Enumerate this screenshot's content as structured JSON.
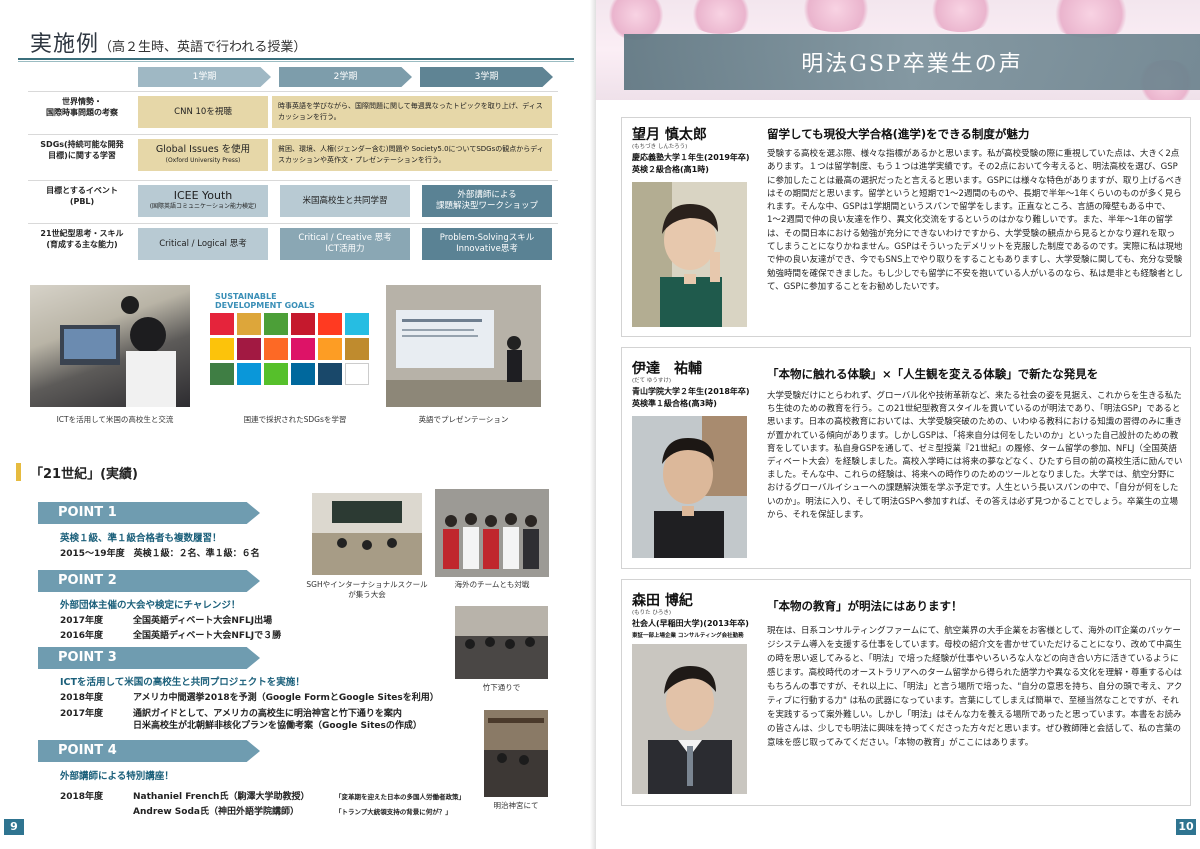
{
  "left": {
    "title": "実施例",
    "subtitle": "（高２生時、英語で行われる授業）",
    "terms": [
      "1学期",
      "2学期",
      "3学期"
    ],
    "rows": [
      {
        "label": "世界情勢・\n国際時事問題の考察",
        "c1": "CNN 10を視聴",
        "c2": "時事英語を学びながら、国際問題に関して毎週異なったトピックを取り上げ、ディスカッションを行う。"
      },
      {
        "label": "SDGs(持続可能な開発\n目標)に関する学習",
        "c1": "Global Issues を使用",
        "c1_small": "(Oxford University Press)",
        "c2": "貧困、環境、人権(ジェンダー含む)問題や Society5.0についてSDGsの観点からディスカッションや英作文・プレゼンテーションを行う。"
      },
      {
        "label": "目標とするイベント\n(PBL)",
        "c1": "ICEE Youth",
        "c1_small": "(国際英語コミュニケーション能力検定)",
        "c2": "米国高校生と共同学習",
        "c3": "外部講師による\n課題解決型ワークショップ"
      },
      {
        "label": "21世紀型思考・スキル\n(育成する主な能力)",
        "c1": "Critical / Logical 思考",
        "c2": "Critical / Creative 思考\nICT活用力",
        "c3": "Problem-Solvingスキル\nInnovative思考"
      }
    ],
    "sdg_title": "SUSTAINABLE\nDEVELOPMENT GOALS",
    "sdg_sub": "17 GOALS TO TRANSFORM OUR WORLD",
    "sdg_colors": [
      "#e5243b",
      "#dda63a",
      "#4c9f38",
      "#c5192d",
      "#ff3a21",
      "#26bde2",
      "#fcc30b",
      "#a21942",
      "#fd6925",
      "#dd1367",
      "#fd9d24",
      "#bf8b2e",
      "#3f7e44",
      "#0a97d9",
      "#56c02b",
      "#00689d",
      "#19486a",
      "#ffffff"
    ],
    "captions": [
      "ICTを活用して米国の高校生と交流",
      "国連で採択されたSDGsを学習",
      "英語でプレゼンテーション"
    ],
    "section_title": "「21世紀」(実績)",
    "points": [
      {
        "label": "POINT 1",
        "lead": "英検１級、準１級合格者も複数履習！",
        "lines": [
          "2015〜19年度　英検１級：２名、準１級：６名"
        ]
      },
      {
        "label": "POINT 2",
        "lead": "外部団体主催の大会や検定にチャレンジ！",
        "lines": [
          "2017年度",
          "全国英語ディベート大会NFLJ出場",
          "2016年度",
          "全国英語ディベート大会NFLJで３勝"
        ]
      },
      {
        "label": "POINT 3",
        "lead": "ICTを活用して米国の高校生と共同プロジェクトを実施！",
        "lines": [
          "2018年度",
          "アメリカ中間選挙2018を予測（Google FormとGoogle Sitesを利用）",
          "2017年度",
          "通訳ガイドとして、アメリカの高校生に明治神宮と竹下通りを案内",
          "日米高校生が北朝鮮非核化プランを協働考案（Google Sitesの作成）"
        ]
      },
      {
        "label": "POINT 4",
        "lead": "外部講師による特別講座！",
        "lines": [
          "2018年度",
          "Nathaniel French氏（駒澤大学助教授）",
          "「変革期を迎えた日本の多国人労働者政策」",
          "Andrew Soda氏（神田外語学院講師）",
          "「トランプ大統領支持の背景に何が？」"
        ]
      }
    ],
    "photo_captions": [
      "SGHやインターナショナルスクール\nが集う大会",
      "海外のチームとも対戦",
      "竹下通りで",
      "明治神宮にて"
    ],
    "page_number": "9"
  },
  "right": {
    "title": "明法GSP卒業生の声",
    "page_number": "10",
    "cards": [
      {
        "name": "望月 慎太郎",
        "kana": "(もちづき しんたろう)",
        "meta1": "慶応義塾大学１年生(2019年卒)",
        "meta2": "英検２級合格(高1時)",
        "headline": "留学しても現役大学合格(進学)をできる制度が魅力",
        "body": "受験する高校を選ぶ際、様々な指標があるかと思います。私が高校受験の際に重視していた点は、大きく2点あります。１つは留学制度、もう１つは進学実績です。その2点において今考えると、明法高校を選び、GSPに参加したことは最高の選択だったと言えると思います。GSPには様々な特色がありますが、取り上げるべきはその期間だと思います。留学というと短期で1〜2週間のものや、長期で半年〜1年くらいのものが多く見られます。そんな中、GSPは1学期間というスパンで留学をします。正直なところ、言語の障壁もある中で、1〜2週間で仲の良い友達を作り、異文化交流をするというのはかなり難しいです。また、半年〜1年の留学は、その間日本における勉強が充分にできないわけですから、大学受験の観点から見るとかなり遅れを取ってしまうことになりかねません。GSPはそういったデメリットを克服した制度であるのです。実際に私は現地で仲の良い友達ができ、今でもSNS上でやり取りをすることもありますし、大学受験に関しても、充分な受験勉強時間を確保できました。もし少しでも留学に不安を抱いている人がいるのなら、私は是非とも経験者として、GSPに参加することをお勧めしたいです。"
      },
      {
        "name": "伊達　祐輔",
        "kana": "(だて ゆうすけ)",
        "meta1": "青山学院大学２年生(2018年卒)",
        "meta2": "英検準１級合格(高3時)",
        "headline": "「本物に触れる体験」×「人生観を変える体験」で新たな発見を",
        "body": "大学受験だけにとらわれず、グローバル化や技術革新など、来たる社会の姿を見据え、これからを生きる私たち生徒のための教育を行う。この21世紀型教育スタイルを貫いているのが明法であり、「明法GSP」であると思います。日本の高校教育においては、大学受験突破のための、いわゆる教科における知識の習得のみに重きが置かれている傾向があります。しかしGSPは、「将来自分は何をしたいのか」といった自己設計のための教育をしています。私自身GSPを通して、ゼミ型授業『21世紀』の履修、ターム留学の参加、NFLJ（全国英語ディベート大会）を経験しました。高校入学時には将来の夢などなく、ひたすら目の前の高校生活に励んでいました。そんな中、これらの経験は、将来への時作りのためのツールとなりました。大学では、航空分野におけるグローバルイシューへの課題解決策を学ぶ予定です。人生という長いスパンの中で、「自分が何をしたいのか」。明法に入り、そして明法GSPへ参加すれば、その答えは必ず見つかることでしょう。卒業生の立場から、それを保証します。"
      },
      {
        "name": "森田 博紀",
        "kana": "(もりた ひろき)",
        "meta1": "社会人(早稲田大学)(2013年卒)",
        "meta2": "東証一部上場企業 コンサルティング会社勤務",
        "headline": "「本物の教育」が明法にはあります！",
        "body": "現在は、日系コンサルティングファームにて、航空業界の大手企業をお客様として、海外のIT企業のパッケージシステム導入を支援する仕事をしています。母校の紹介文を書かせていただけることになり、改めて中高生の時を思い返してみると、「明法」で培った経験が仕事やいろいろな人などの向き合い方に活きているように感じます。高校時代のオーストラリアへのターム留学から得られた語学力や異なる文化を理解・尊重する心はもちろんの事ですが、それ以上に、「明法」と言う場所で培った、\"自分の意思を持ち、自分の頭で考え、アクティブに行動する力\" は私の武器になっています。言葉にしてしまえば簡単で、至極当然なことですが、それを実践するって案外難しい。しかし「明法」はそんな力を養える場所であったと思っています。本書をお読みの皆さんは、少しでも明法に興味を持ってくださった方々だと思います。ぜひ教師陣と会話して、私の言葉の意味を感じ取ってみてください。「本物の教育」がここにはあります。"
      }
    ]
  }
}
